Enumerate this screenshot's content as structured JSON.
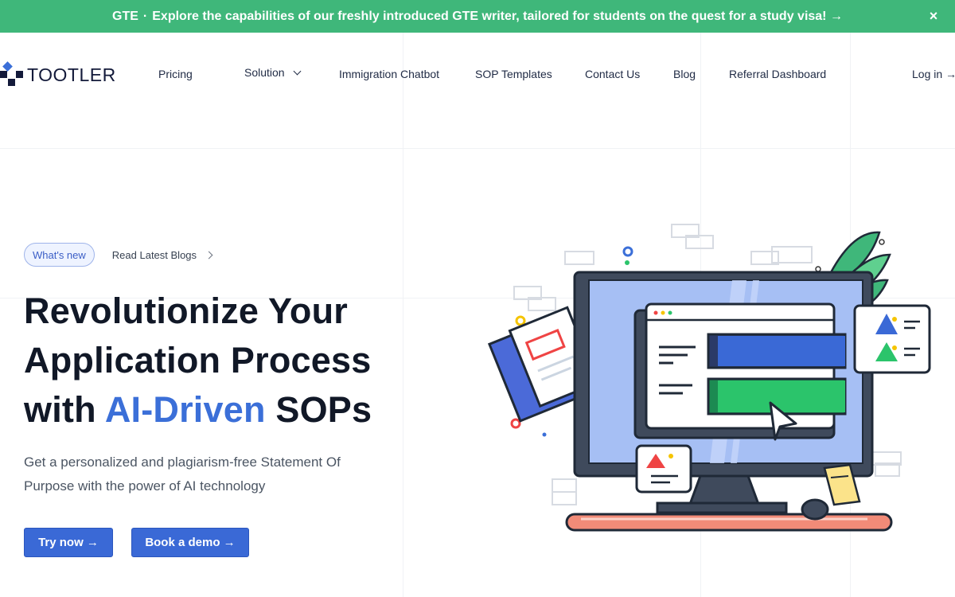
{
  "announcement": {
    "tag": "GTE",
    "separator": "·",
    "text": "Explore the capabilities of our freshly introduced GTE writer, tailored for students on the quest for a study visa! →",
    "close_icon": "×"
  },
  "logo": {
    "text": "TOOTLER"
  },
  "nav": {
    "pricing": "Pricing",
    "solution": "Solution",
    "chatbot": "Immigration Chatbot",
    "templates": "SOP Templates",
    "contact": "Contact Us",
    "blog": "Blog",
    "referral": "Referral Dashboard",
    "login": "Log in →"
  },
  "hero": {
    "pill": "What's new",
    "pill_link": "Read Latest Blogs",
    "headline_1": "Revolutionize Your",
    "headline_2": "Application Process",
    "headline_3a": "with ",
    "headline_3b": "AI-Driven",
    "headline_3c": " SOPs",
    "subtext": "Get a personalized and plagiarism-free Statement Of Purpose with the power of AI technology",
    "try_button": "Try now →",
    "demo_button": "Book a demo →"
  },
  "colors": {
    "announce_bg": "#3fb77a",
    "accent": "#3b6fd8",
    "button": "#3a69d6"
  }
}
